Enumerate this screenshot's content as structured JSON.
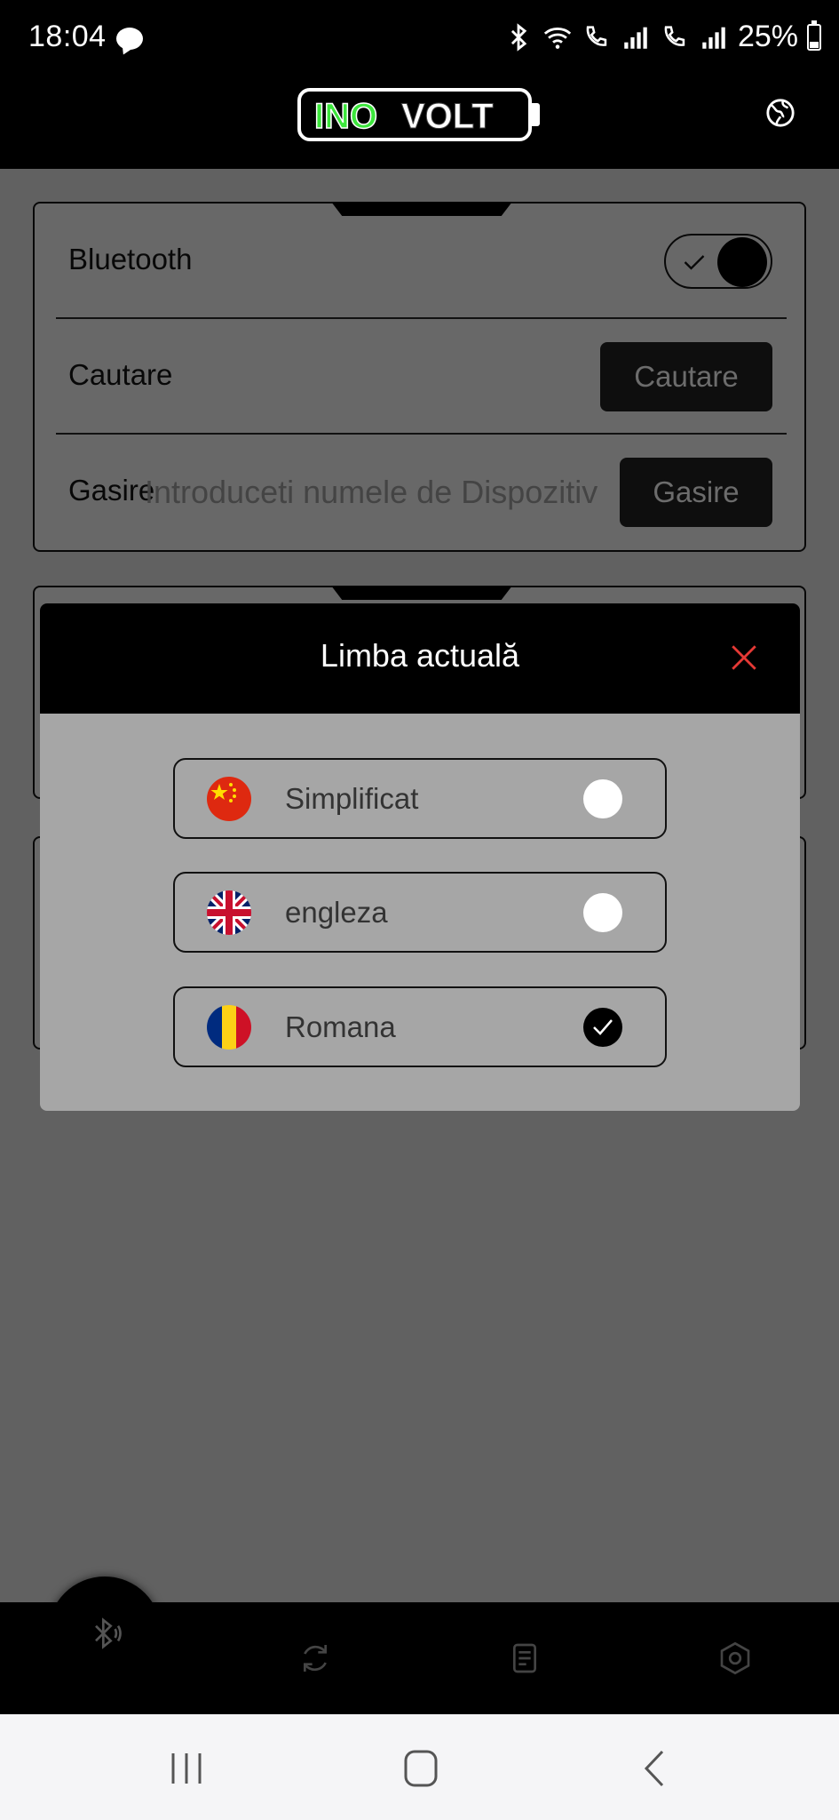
{
  "status_bar": {
    "time": "18:04",
    "battery": "25%",
    "icons": [
      "chat-bubble-icon",
      "bluetooth-icon",
      "wifi-icon",
      "volte-call-icon",
      "signal-icon",
      "wifi-call-icon",
      "signal-icon"
    ]
  },
  "header": {
    "logo_text_a": "INO",
    "logo_text_b": "VOLT",
    "logo_colors": {
      "ino": "#3ce63c",
      "volt": "#ffffff"
    },
    "language_icon": "globe-icon"
  },
  "main": {
    "bluetooth_label": "Bluetooth",
    "bluetooth_enabled": true,
    "search_label": "Cautare",
    "search_button": "Cautare",
    "find_label": "Gasire",
    "find_placeholder": "Introduceti numele de Dispozitiv",
    "find_button": "Gasire"
  },
  "bottom_nav": {
    "icons": [
      "bluetooth-icon",
      "refresh-icon",
      "document-icon",
      "settings-icon"
    ]
  },
  "dialog": {
    "title": "Limba actuală",
    "close_icon": "close-icon",
    "close_color": "#e53935",
    "options": [
      {
        "label": "Simplificat",
        "flag": "china-flag-icon",
        "selected": false
      },
      {
        "label": "engleza",
        "flag": "uk-flag-icon",
        "selected": false
      },
      {
        "label": "Romana",
        "flag": "romania-flag-icon",
        "selected": true
      }
    ]
  },
  "system_nav": {
    "buttons": [
      "recents-icon",
      "home-icon",
      "back-icon"
    ]
  }
}
